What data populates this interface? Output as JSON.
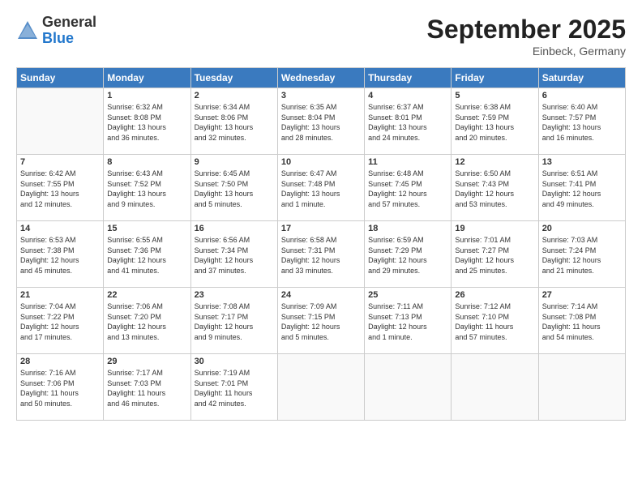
{
  "header": {
    "logo_general": "General",
    "logo_blue": "Blue",
    "month_title": "September 2025",
    "location": "Einbeck, Germany"
  },
  "weekdays": [
    "Sunday",
    "Monday",
    "Tuesday",
    "Wednesday",
    "Thursday",
    "Friday",
    "Saturday"
  ],
  "weeks": [
    [
      {
        "day": "",
        "info": ""
      },
      {
        "day": "1",
        "info": "Sunrise: 6:32 AM\nSunset: 8:08 PM\nDaylight: 13 hours\nand 36 minutes."
      },
      {
        "day": "2",
        "info": "Sunrise: 6:34 AM\nSunset: 8:06 PM\nDaylight: 13 hours\nand 32 minutes."
      },
      {
        "day": "3",
        "info": "Sunrise: 6:35 AM\nSunset: 8:04 PM\nDaylight: 13 hours\nand 28 minutes."
      },
      {
        "day": "4",
        "info": "Sunrise: 6:37 AM\nSunset: 8:01 PM\nDaylight: 13 hours\nand 24 minutes."
      },
      {
        "day": "5",
        "info": "Sunrise: 6:38 AM\nSunset: 7:59 PM\nDaylight: 13 hours\nand 20 minutes."
      },
      {
        "day": "6",
        "info": "Sunrise: 6:40 AM\nSunset: 7:57 PM\nDaylight: 13 hours\nand 16 minutes."
      }
    ],
    [
      {
        "day": "7",
        "info": "Sunrise: 6:42 AM\nSunset: 7:55 PM\nDaylight: 13 hours\nand 12 minutes."
      },
      {
        "day": "8",
        "info": "Sunrise: 6:43 AM\nSunset: 7:52 PM\nDaylight: 13 hours\nand 9 minutes."
      },
      {
        "day": "9",
        "info": "Sunrise: 6:45 AM\nSunset: 7:50 PM\nDaylight: 13 hours\nand 5 minutes."
      },
      {
        "day": "10",
        "info": "Sunrise: 6:47 AM\nSunset: 7:48 PM\nDaylight: 13 hours\nand 1 minute."
      },
      {
        "day": "11",
        "info": "Sunrise: 6:48 AM\nSunset: 7:45 PM\nDaylight: 12 hours\nand 57 minutes."
      },
      {
        "day": "12",
        "info": "Sunrise: 6:50 AM\nSunset: 7:43 PM\nDaylight: 12 hours\nand 53 minutes."
      },
      {
        "day": "13",
        "info": "Sunrise: 6:51 AM\nSunset: 7:41 PM\nDaylight: 12 hours\nand 49 minutes."
      }
    ],
    [
      {
        "day": "14",
        "info": "Sunrise: 6:53 AM\nSunset: 7:38 PM\nDaylight: 12 hours\nand 45 minutes."
      },
      {
        "day": "15",
        "info": "Sunrise: 6:55 AM\nSunset: 7:36 PM\nDaylight: 12 hours\nand 41 minutes."
      },
      {
        "day": "16",
        "info": "Sunrise: 6:56 AM\nSunset: 7:34 PM\nDaylight: 12 hours\nand 37 minutes."
      },
      {
        "day": "17",
        "info": "Sunrise: 6:58 AM\nSunset: 7:31 PM\nDaylight: 12 hours\nand 33 minutes."
      },
      {
        "day": "18",
        "info": "Sunrise: 6:59 AM\nSunset: 7:29 PM\nDaylight: 12 hours\nand 29 minutes."
      },
      {
        "day": "19",
        "info": "Sunrise: 7:01 AM\nSunset: 7:27 PM\nDaylight: 12 hours\nand 25 minutes."
      },
      {
        "day": "20",
        "info": "Sunrise: 7:03 AM\nSunset: 7:24 PM\nDaylight: 12 hours\nand 21 minutes."
      }
    ],
    [
      {
        "day": "21",
        "info": "Sunrise: 7:04 AM\nSunset: 7:22 PM\nDaylight: 12 hours\nand 17 minutes."
      },
      {
        "day": "22",
        "info": "Sunrise: 7:06 AM\nSunset: 7:20 PM\nDaylight: 12 hours\nand 13 minutes."
      },
      {
        "day": "23",
        "info": "Sunrise: 7:08 AM\nSunset: 7:17 PM\nDaylight: 12 hours\nand 9 minutes."
      },
      {
        "day": "24",
        "info": "Sunrise: 7:09 AM\nSunset: 7:15 PM\nDaylight: 12 hours\nand 5 minutes."
      },
      {
        "day": "25",
        "info": "Sunrise: 7:11 AM\nSunset: 7:13 PM\nDaylight: 12 hours\nand 1 minute."
      },
      {
        "day": "26",
        "info": "Sunrise: 7:12 AM\nSunset: 7:10 PM\nDaylight: 11 hours\nand 57 minutes."
      },
      {
        "day": "27",
        "info": "Sunrise: 7:14 AM\nSunset: 7:08 PM\nDaylight: 11 hours\nand 54 minutes."
      }
    ],
    [
      {
        "day": "28",
        "info": "Sunrise: 7:16 AM\nSunset: 7:06 PM\nDaylight: 11 hours\nand 50 minutes."
      },
      {
        "day": "29",
        "info": "Sunrise: 7:17 AM\nSunset: 7:03 PM\nDaylight: 11 hours\nand 46 minutes."
      },
      {
        "day": "30",
        "info": "Sunrise: 7:19 AM\nSunset: 7:01 PM\nDaylight: 11 hours\nand 42 minutes."
      },
      {
        "day": "",
        "info": ""
      },
      {
        "day": "",
        "info": ""
      },
      {
        "day": "",
        "info": ""
      },
      {
        "day": "",
        "info": ""
      }
    ]
  ]
}
